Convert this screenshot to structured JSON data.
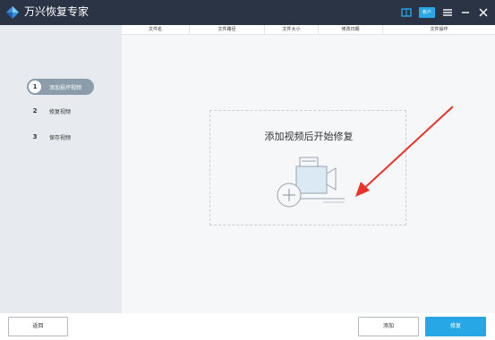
{
  "app": {
    "title": "万兴恢复专家"
  },
  "titlebar": {
    "account_label": "帐户"
  },
  "sidebar": {
    "steps": [
      {
        "num": "1",
        "label": "添加损坏视频"
      },
      {
        "num": "2",
        "label": "修复视频"
      },
      {
        "num": "3",
        "label": "保存视频"
      }
    ]
  },
  "table": {
    "headers": [
      "文件名",
      "文件路径",
      "文件大小",
      "修改日期",
      "文件操作"
    ]
  },
  "main": {
    "drop_text": "添加视频后开始修复"
  },
  "footer": {
    "back_label": "返回",
    "add_label": "添加",
    "repair_label": "修复"
  },
  "colors": {
    "titlebar_bg": "#2b3445",
    "accent": "#27a7e5",
    "sidebar_bg": "#e7ebef",
    "active_step_bg": "#8b9cab",
    "arrow": "#e8332b"
  }
}
